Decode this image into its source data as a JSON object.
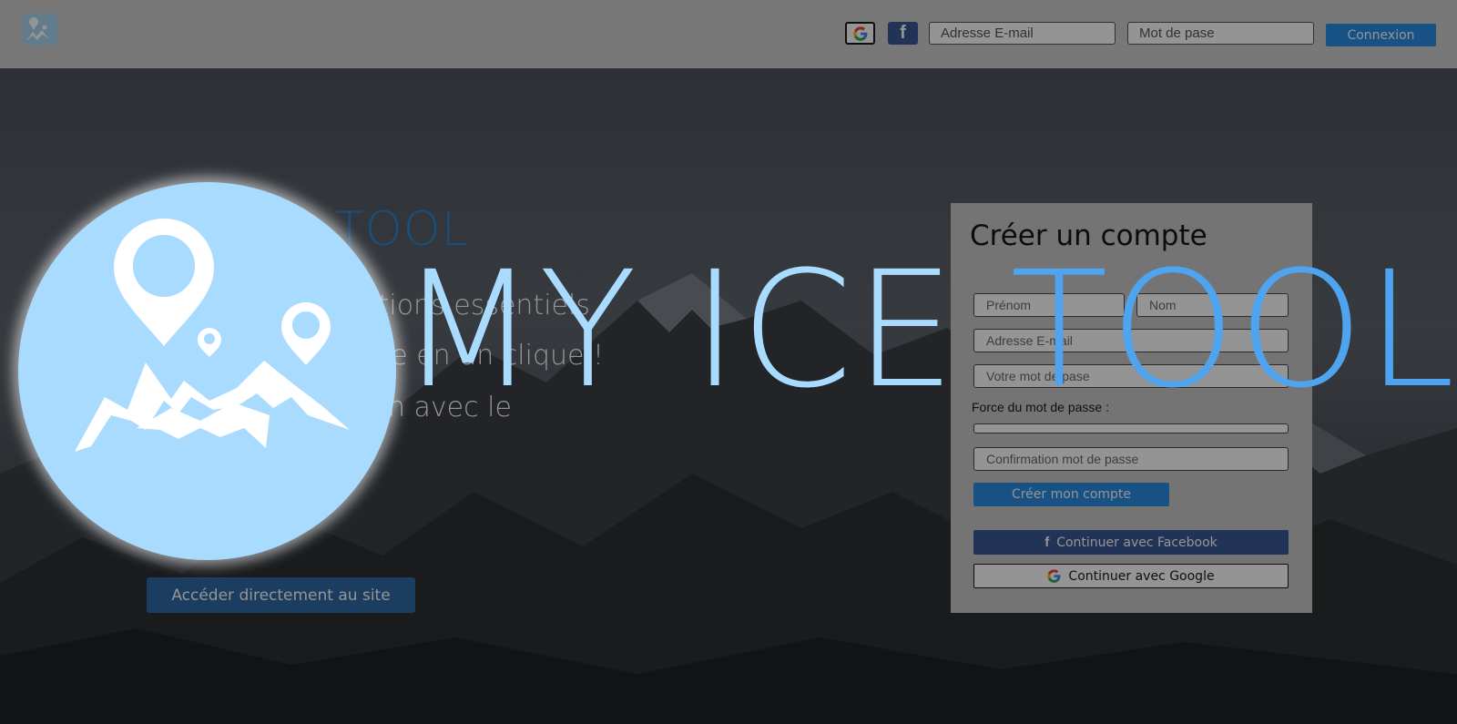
{
  "topbar": {
    "google_icon": "google-g-icon",
    "facebook_icon": "facebook-f-icon",
    "facebook_glyph": "f",
    "email_placeholder": "Adresse E-mail",
    "password_placeholder": "Mot de pase",
    "login_label": "Connexion"
  },
  "hero": {
    "title": "TOOL",
    "line1": "mations essentiels",
    "line2": "glace en un clique !",
    "line3": "ssion avec le",
    "direct_button": "Accéder directement au site"
  },
  "signup": {
    "title": "Créer un compte",
    "firstname_placeholder": "Prénom",
    "lastname_placeholder": "Nom",
    "email_placeholder": "Adresse E-mail",
    "password_placeholder": "Votre mot de pase",
    "strength_label": "Force du mot de passe :",
    "confirm_placeholder": "Confirmation mot de passe",
    "create_button": "Créer mon compte",
    "facebook_glyph": "f",
    "facebook_button": "Continuer avec Facebook",
    "google_button": "Continuer avec Google"
  },
  "splash": {
    "word1": "MY ICE ",
    "word2": "TOOL",
    "logo_icon": "mountain-pins-logo-icon"
  },
  "colors": {
    "accent_blue": "#2a8de5",
    "facebook_blue": "#3b5998",
    "splash_light": "#a9dbff",
    "splash_blue": "#4ea4ee"
  }
}
